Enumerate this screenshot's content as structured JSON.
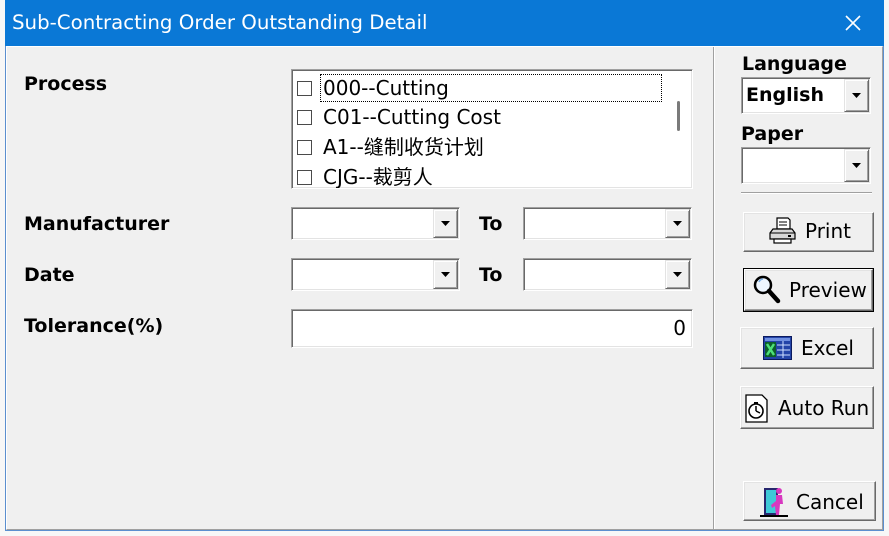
{
  "window": {
    "title": "Sub-Contracting Order Outstanding Detail",
    "close_icon": "close-icon"
  },
  "form": {
    "process": {
      "label": "Process",
      "items": [
        {
          "label": "000--Cutting",
          "checked": false
        },
        {
          "label": "C01--Cutting Cost",
          "checked": false
        },
        {
          "label": "A1--缝制收货计划",
          "checked": false
        },
        {
          "label": "CJG--裁剪人",
          "checked": false
        }
      ]
    },
    "manufacturer": {
      "label": "Manufacturer",
      "from": "",
      "to_label": "To",
      "to": ""
    },
    "date": {
      "label": "Date",
      "from": "",
      "to_label": "To",
      "to": ""
    },
    "tolerance": {
      "label": "Tolerance(%)",
      "value": "0"
    }
  },
  "side_panel": {
    "language": {
      "label": "Language",
      "value": "English"
    },
    "paper": {
      "label": "Paper",
      "value": ""
    },
    "buttons": [
      {
        "label": "Print",
        "icon": "printer-icon"
      },
      {
        "label": "Preview",
        "icon": "magnifier-icon",
        "is_default": true
      },
      {
        "label": "Excel",
        "icon": "excel-icon"
      },
      {
        "label": "Auto Run",
        "icon": "clock-icon"
      },
      {
        "label": "Cancel",
        "icon": "exit-door-icon"
      }
    ]
  },
  "colors": {
    "title_bar": "#0a78d6",
    "title_text": "#ffffff",
    "dialog_face": "#f0f0f0",
    "field_background": "#ffffff"
  }
}
